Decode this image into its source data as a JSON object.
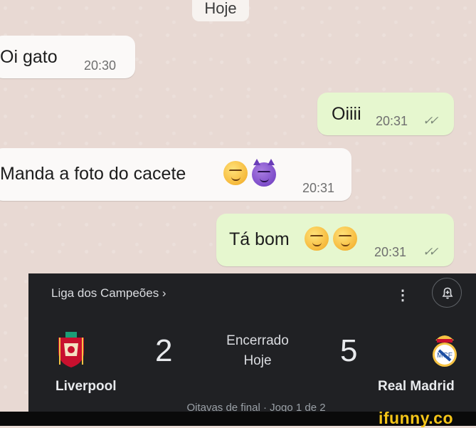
{
  "chat": {
    "date_label": "Hoje",
    "messages": [
      {
        "text": "Oi gato",
        "time": "20:30",
        "direction": "in"
      },
      {
        "text": "Oiiii",
        "time": "20:31",
        "direction": "out"
      },
      {
        "text": "Manda a foto do cacete",
        "time": "20:31",
        "direction": "in",
        "emojis": [
          "smirking-face",
          "smiling-devil"
        ]
      },
      {
        "text": "Tá bom",
        "time": "20:31",
        "direction": "out",
        "emojis": [
          "smirking-face",
          "smirking-face"
        ]
      }
    ],
    "colors": {
      "incoming": "#fbf9f8",
      "outgoing": "#e6f7cf",
      "background": "#e8d9d3"
    }
  },
  "match": {
    "competition": "Liga dos Campeões ›",
    "home": {
      "name": "Liverpool",
      "score": "2",
      "logo": "liverpool-crest"
    },
    "away": {
      "name": "Real Madrid",
      "score": "5",
      "logo": "real-madrid-crest"
    },
    "status": "Encerrado",
    "date": "Hoje",
    "round": "Oitavas de final · Jogo 1 de 2",
    "menu_icon": "more-vert-icon",
    "notify_icon": "bell-add-icon",
    "colors": {
      "card": "#202124",
      "text": "#e8eaed"
    }
  },
  "watermark": {
    "text": "ifunny.co",
    "color": "#f5c518"
  }
}
